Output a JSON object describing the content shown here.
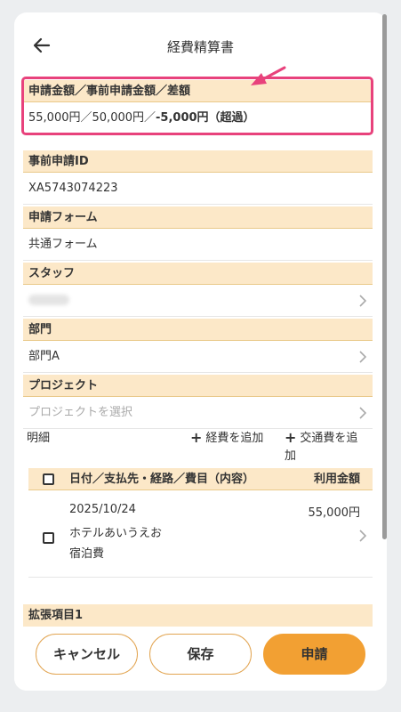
{
  "header": {
    "title": "経費精算書"
  },
  "amount": {
    "label": "申請金額／事前申請金額／差額",
    "applied": "55,000円",
    "separator": "／",
    "pre_applied": "50,000円",
    "difference": "-5,000円（超過）"
  },
  "pre_application": {
    "label": "事前申請ID",
    "value": "XA5743074223"
  },
  "form": {
    "label": "申請フォーム",
    "value": "共通フォーム"
  },
  "staff": {
    "label": "スタッフ"
  },
  "department": {
    "label": "部門",
    "value": "部門A"
  },
  "project": {
    "label": "プロジェクト",
    "placeholder": "プロジェクトを選択"
  },
  "details": {
    "label": "明細",
    "add_expense": "経費を追加",
    "add_transport": "交通費を追加",
    "columns": {
      "desc": "日付／支払先・経路／費目（内容）",
      "amount": "利用金額"
    },
    "rows": [
      {
        "date": "2025/10/24",
        "payee": "ホテルあいうえお",
        "category": "宿泊費",
        "amount": "55,000円"
      }
    ]
  },
  "extension": {
    "label": "拡張項目1"
  },
  "footer": {
    "cancel": "キャンセル",
    "save": "保存",
    "submit": "申請"
  },
  "colors": {
    "header_bg": "#fce8c8",
    "primary": "#f2a033",
    "highlight": "#e8427c"
  }
}
